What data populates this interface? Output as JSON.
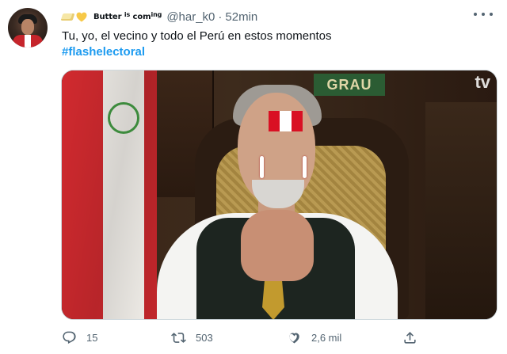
{
  "tweet": {
    "author": {
      "name_prefix_emoji": [
        "butter",
        "yellow-heart"
      ],
      "name_part1": "Butter ",
      "name_part2": "is",
      "name_part3": " com",
      "name_part4": "ing",
      "handle": "@har_k0",
      "separator": "·",
      "time": "52min"
    },
    "text": "Tu, yo, el vecino y todo el Perú en estos momentos",
    "hashtag": "#flashelectoral",
    "media": {
      "plaque_text": "GRAU",
      "channel_logo": "tv"
    },
    "actions": {
      "reply_count": "15",
      "retweet_count": "503",
      "like_count": "2,6 mil"
    }
  },
  "colors": {
    "accent": "#1d9bf0",
    "muted": "#536471",
    "text": "#0f1419",
    "flag_red": "#d91023",
    "flag_white": "#ffffff"
  },
  "icons": [
    "more-icon",
    "reply-icon",
    "retweet-icon",
    "like-icon",
    "share-icon"
  ]
}
